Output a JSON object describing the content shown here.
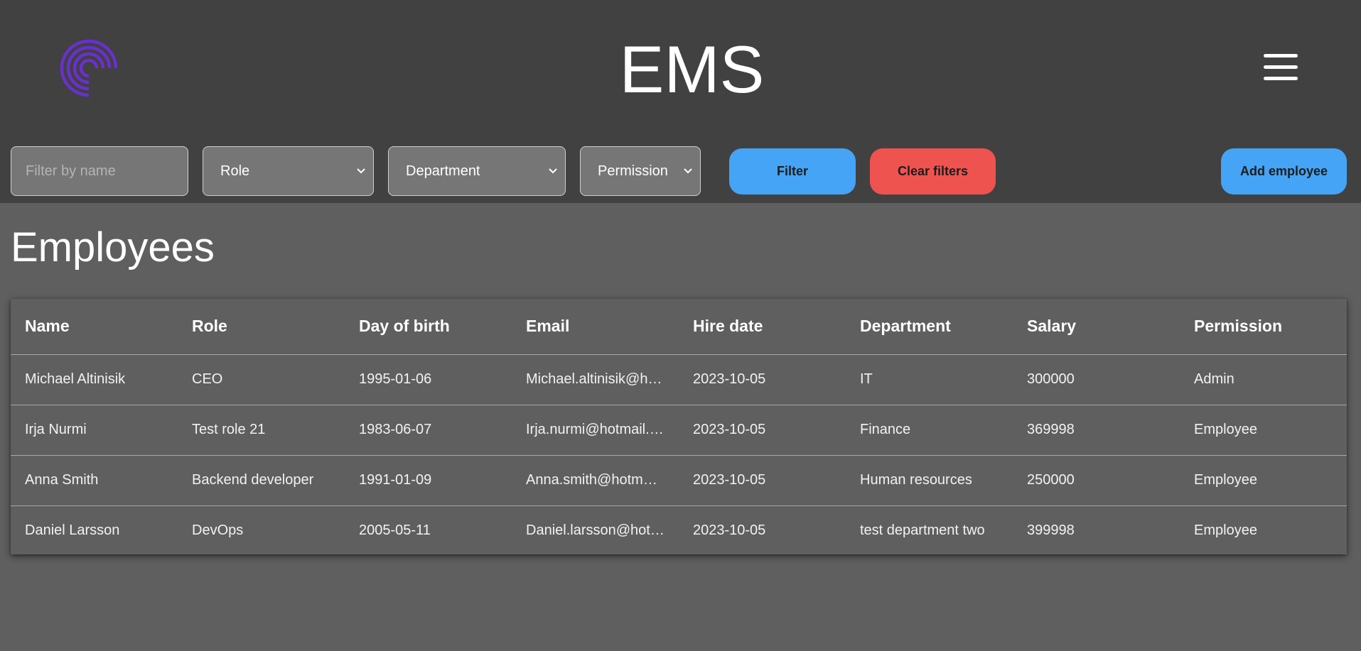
{
  "header": {
    "title": "EMS",
    "logo_icon": "rainbow-arcs-logo",
    "logo_color": "#6a2fd0",
    "menu_icon": "hamburger-icon"
  },
  "filters": {
    "name_placeholder": "Filter by name",
    "role_selected": "Role",
    "department_selected": "Department",
    "permission_selected": "Permission",
    "filter_label": "Filter",
    "clear_label": "Clear filters",
    "add_label": "Add employee"
  },
  "colors": {
    "primary_button": "#45a4f5",
    "danger_button": "#ef5350"
  },
  "main": {
    "title": "Employees"
  },
  "table": {
    "headers": [
      "Name",
      "Role",
      "Day of birth",
      "Email",
      "Hire date",
      "Department",
      "Salary",
      "Permission"
    ],
    "rows": [
      [
        "Michael Altinisik",
        "CEO",
        "1995-01-06",
        "Michael.altinisik@hotmail.com",
        "2023-10-05",
        "IT",
        "300000",
        "Admin"
      ],
      [
        "Irja Nurmi",
        "Test role 21",
        "1983-06-07",
        "Irja.nurmi@hotmail.com",
        "2023-10-05",
        "Finance",
        "369998",
        "Employee"
      ],
      [
        "Anna Smith",
        "Backend developer",
        "1991-01-09",
        "Anna.smith@hotmail.com",
        "2023-10-05",
        "Human resources",
        "250000",
        "Employee"
      ],
      [
        "Daniel Larsson",
        "DevOps",
        "2005-05-11",
        "Daniel.larsson@hotmail.com",
        "2023-10-05",
        "test department two",
        "399998",
        "Employee"
      ]
    ]
  }
}
